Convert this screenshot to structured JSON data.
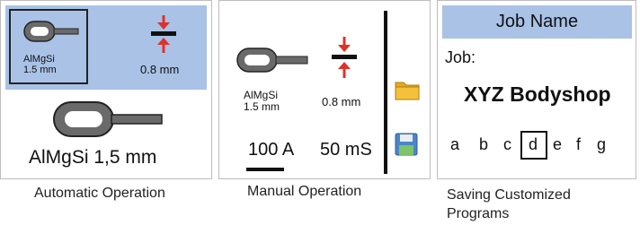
{
  "auto": {
    "small_key_label_line1": "AlMgSi",
    "small_key_label_line2": "1.5 mm",
    "thickness_value": "0.8 mm",
    "large_key_label": "AlMgSi 1,5 mm",
    "caption": "Automatic Operation"
  },
  "manual": {
    "key_label_line1": "AlMgSi",
    "key_label_line2": "1.5 mm",
    "thickness_value": "0.8 mm",
    "current_value": "100 A",
    "time_value": "50 mS",
    "caption": "Manual Operation"
  },
  "job": {
    "header_title": "Job Name",
    "job_label": "Job:",
    "job_value": "XYZ Bodyshop",
    "letters": [
      "a",
      "b",
      "c",
      "d",
      "e",
      "f",
      "g"
    ],
    "selected_letter_index": 3,
    "caption_line1": "Saving Customized",
    "caption_line2": "Programs"
  },
  "colors": {
    "header_blue": "#a9c2e6",
    "arrow_red": "#e03128",
    "folder_yellow": "#f3c23a",
    "save_blue": "#4a86c8"
  },
  "icons": [
    "key-icon",
    "thickness-icon",
    "folder-icon",
    "save-icon"
  ]
}
